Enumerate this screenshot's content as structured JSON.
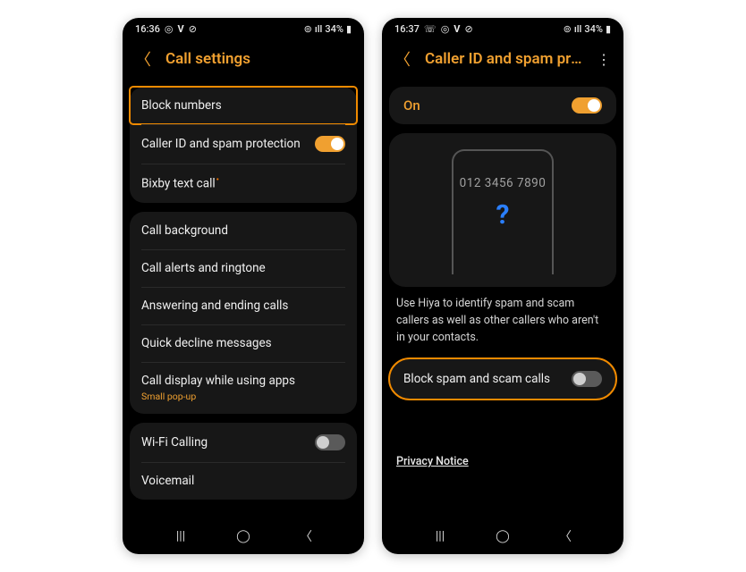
{
  "left": {
    "status": {
      "time": "16:36",
      "battery": "34%"
    },
    "header": {
      "title": "Call settings"
    },
    "group1": {
      "block_numbers": "Block numbers",
      "caller_id": "Caller ID and spam protection",
      "bixby": "Bixby text call"
    },
    "group2": {
      "call_bg": "Call background",
      "alerts": "Call alerts and ringtone",
      "answering": "Answering and ending calls",
      "decline": "Quick decline messages",
      "display": "Call display while using apps",
      "display_sub": "Small pop-up"
    },
    "group3": {
      "wifi": "Wi-Fi Calling",
      "voicemail": "Voicemail"
    }
  },
  "right": {
    "status": {
      "time": "16:37",
      "battery": "34%"
    },
    "header": {
      "title": "Caller ID and spam pro…"
    },
    "on_label": "On",
    "phone_number": "012 3456 7890",
    "question": "?",
    "description": "Use Hiya to identify spam and scam callers as well as other callers who aren't in your contacts.",
    "block_spam": "Block spam and scam calls",
    "privacy": "Privacy Notice"
  }
}
